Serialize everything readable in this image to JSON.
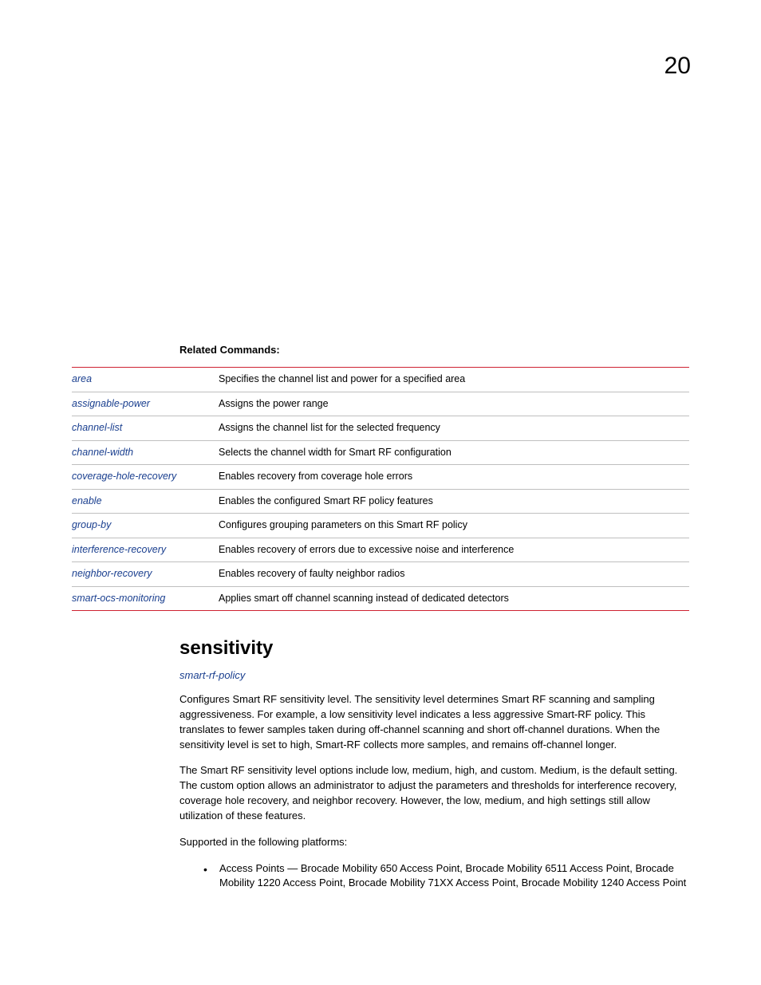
{
  "chapter_number": "20",
  "related_heading": "Related Commands:",
  "related_commands": [
    {
      "name": "area",
      "desc": "Specifies the channel list and power for a specified area"
    },
    {
      "name": "assignable-power",
      "desc": "Assigns the power range"
    },
    {
      "name": "channel-list",
      "desc": "Assigns the channel list for the selected frequency"
    },
    {
      "name": "channel-width",
      "desc": "Selects the channel width for Smart RF configuration"
    },
    {
      "name": "coverage-hole-recovery",
      "desc": "Enables recovery from coverage hole errors"
    },
    {
      "name": "enable",
      "desc": "Enables the configured Smart RF policy features"
    },
    {
      "name": "group-by",
      "desc": "Configures grouping parameters on this Smart RF policy"
    },
    {
      "name": "interference-recovery",
      "desc": "Enables recovery of errors due to excessive noise and interference"
    },
    {
      "name": "neighbor-recovery",
      "desc": "Enables recovery of faulty neighbor radios"
    },
    {
      "name": "smart-ocs-monitoring",
      "desc": "Applies smart off channel scanning instead of dedicated detectors"
    }
  ],
  "section_heading": "sensitivity",
  "policy_link": "smart-rf-policy",
  "para1": "Configures Smart RF sensitivity level. The sensitivity level determines Smart RF scanning and sampling aggressiveness. For example, a low sensitivity level indicates a less aggressive Smart-RF policy. This translates to fewer samples taken during off-channel scanning and short off-channel durations. When the sensitivity level is set to high, Smart-RF collects more samples, and remains off-channel longer.",
  "para2": "The Smart RF sensitivity level options include low, medium, high, and custom. Medium, is the default setting. The custom option allows an administrator to adjust the parameters and thresholds for interference recovery, coverage hole recovery, and neighbor recovery. However, the low, medium, and high settings still allow utilization of these features.",
  "para3": "Supported in the following platforms:",
  "bullet1": "Access Points — Brocade Mobility 650 Access Point, Brocade Mobility 6511 Access Point, Brocade Mobility 1220 Access Point, Brocade Mobility 71XX Access Point, Brocade Mobility 1240 Access Point"
}
